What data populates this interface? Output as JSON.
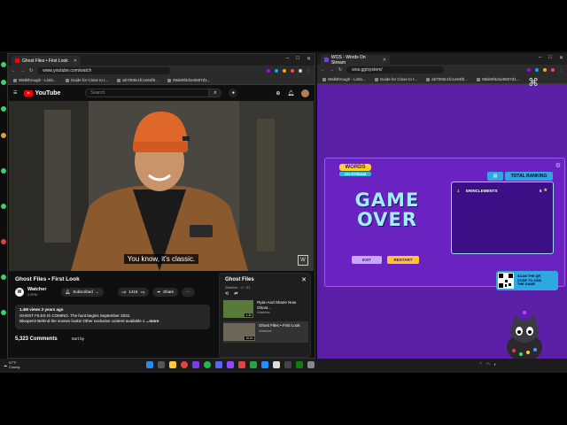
{
  "left_window": {
    "tab_title": "Ghost Files • First Look",
    "url": "www.youtube.com/watch",
    "bookmarks": [
      "Walkthrough - Limb...",
      "Guide for Close to t...",
      "ab7006c1fc1e64f6...",
      "09de9f4d1e0607d1..."
    ]
  },
  "right_window": {
    "tab_title": "WOS - Words On Stream",
    "url": "wos.gg/system/",
    "bookmarks": [
      "Walkthrough - Limb...",
      "Guide for Close to t...",
      "ab7006c1fc1e64f6...",
      "09de9f4d1e0607d1..."
    ]
  },
  "youtube": {
    "logo_text": "YouTube",
    "search_placeholder": "Search",
    "video_subtitle": "You know, it's classic.",
    "video_title": "Ghost Files • First Look",
    "channel_name": "Watcher",
    "channel_subs": "2.87M",
    "subscribe_label": "Subscribed",
    "like_count": "141K",
    "share_label": "Share",
    "more_label": "⋯",
    "desc_stats": "1.4M views  2 years ago",
    "desc_line1": "GHOST FILES IS COMING. The hunt begins September 2022.",
    "desc_line2": "Bloopers! Behind the scenes looks! Other exclusive content available o",
    "desc_more": "...more",
    "comments_count": "5,323 Comments",
    "sort_label": "Sort by",
    "playlist": {
      "title": "Ghost Files",
      "subtitle": "Watcher - 2 / 31",
      "items": [
        {
          "title": "Ryan And Shane Now Ghost...",
          "channel": "Watcher",
          "duration": "1:32"
        },
        {
          "title": "Ghost Files • First Look",
          "channel": "Watcher",
          "duration": "10:01"
        }
      ]
    }
  },
  "wos": {
    "logo_line1": "WORDS",
    "logo_line2": "ON STREAM",
    "game_over_line1": "GAME",
    "game_over_line2": "OVER",
    "exit_label": "EXIT",
    "restart_label": "RESTART",
    "ranking_label": "TOTAL RANKING",
    "ranking": [
      {
        "rank": "1",
        "name": "ERINCLEMENTS",
        "points": "6"
      }
    ],
    "qr_text_1": "SCAN THE QR",
    "qr_text_2": "CODE TO JOIN",
    "qr_text_3": "THE GAME"
  },
  "taskbar": {
    "temperature": "57°F",
    "weather": "Cloudy"
  },
  "colors": {
    "wos_bg": "#5b1fa8",
    "wos_card": "#6a22c0",
    "yt_red": "#ff0000"
  }
}
